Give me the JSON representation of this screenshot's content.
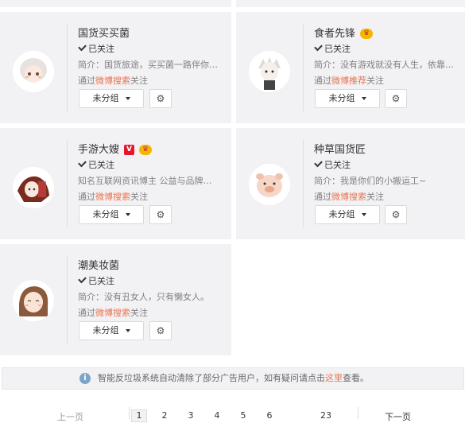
{
  "cards": [
    {
      "name": "国货买买菌",
      "badges": [],
      "followed": "已关注",
      "bio": "简介：国货旅途，买买菌一路伴你…",
      "via_prefix": "通过",
      "via_link": "微博搜索",
      "via_suffix": "关注",
      "group_label": "未分组"
    },
    {
      "name": "食者先锋",
      "badges": [
        "vip"
      ],
      "followed": "已关注",
      "bio": "简介：没有游戏就没有人生，依靠…",
      "via_prefix": "通过",
      "via_link": "微博推荐",
      "via_suffix": "关注",
      "group_label": "未分组"
    },
    {
      "name": "手游大嫂",
      "badges": [
        "v",
        "vip"
      ],
      "followed": "已关注",
      "bio": "知名互联网资讯博主 公益与品牌…",
      "via_prefix": "通过",
      "via_link": "微博搜索",
      "via_suffix": "关注",
      "group_label": "未分组"
    },
    {
      "name": "种草国货匠",
      "badges": [],
      "followed": "已关注",
      "bio": "简介：我是你们的小搬运工~",
      "via_prefix": "通过",
      "via_link": "微博搜索",
      "via_suffix": "关注",
      "group_label": "未分组"
    },
    {
      "name": "潮美妆菌",
      "badges": [],
      "followed": "已关注",
      "bio": "简介：没有丑女人，只有懒女人。",
      "via_prefix": "通过",
      "via_link": "微博搜索",
      "via_suffix": "关注",
      "group_label": "未分组"
    }
  ],
  "badge_text": {
    "v": "V",
    "vip": "♛"
  },
  "notice": {
    "text_before": "智能反垃圾系统自动清除了部分广告用户，如有疑问请点击",
    "link": "这里",
    "text_after": "查看。"
  },
  "pager": {
    "prev": "上一页",
    "next": "下一页",
    "pages": [
      "1",
      "2",
      "3",
      "4",
      "5",
      "6",
      "23"
    ],
    "current": "1"
  },
  "colors": {
    "card_bg": "#f2f2f5",
    "link": "#eb7350",
    "v_badge": "#e6162d",
    "vip_badge": "#f7b500",
    "info_icon": "#7ea4c9"
  }
}
